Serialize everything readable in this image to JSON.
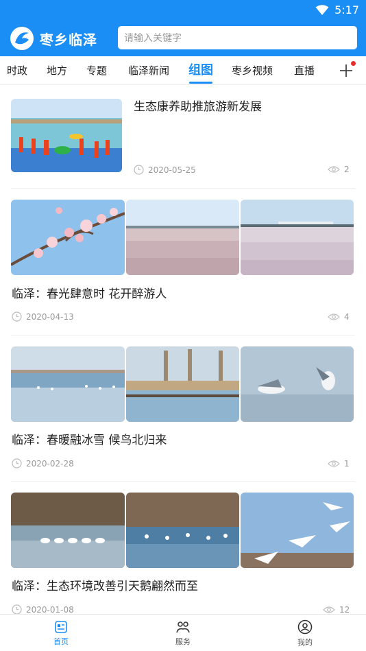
{
  "status": {
    "time": "5:17"
  },
  "header": {
    "app_name": "枣乡临泽",
    "search_placeholder": "请输入关键字"
  },
  "tabs": [
    "时政",
    "地方",
    "专题",
    "临泽新闻",
    "组图",
    "枣乡视频",
    "直播"
  ],
  "active_tab": "组图",
  "articles": [
    {
      "title": "生态康养助推旅游新发展",
      "date": "2020-05-25",
      "views": "2"
    },
    {
      "title": "临泽：春光肆意时 花开醉游人",
      "date": "2020-04-13",
      "views": "4"
    },
    {
      "title": "临泽：春暖融冰雪 候鸟北归来",
      "date": "2020-02-28",
      "views": "1"
    },
    {
      "title": "临泽：生态环境改善引天鹅翩然而至",
      "date": "2020-01-08",
      "views": "12"
    }
  ],
  "bottom_nav": [
    {
      "label": "首页",
      "icon": "home-icon",
      "active": true
    },
    {
      "label": "服务",
      "icon": "service-icon",
      "active": false
    },
    {
      "label": "我的",
      "icon": "profile-icon",
      "active": false
    }
  ],
  "colors": {
    "brand": "#1a8ef5",
    "badge": "#e82b2b"
  }
}
